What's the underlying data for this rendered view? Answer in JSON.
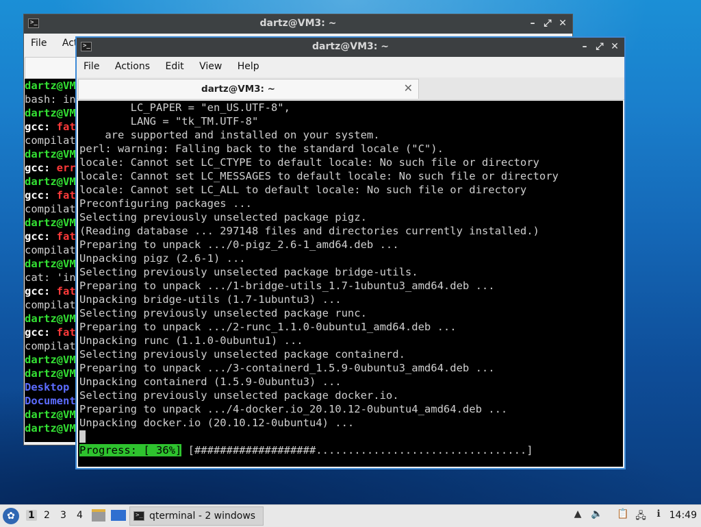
{
  "back_window": {
    "title": "dartz@VM3: ~",
    "menu": [
      "File",
      "Act"
    ],
    "lines": [
      {
        "t": "dartz@VM",
        "c": "g"
      },
      {
        "t": "bash: in",
        "c": ""
      },
      {
        "t": "dartz@VM",
        "c": "g"
      },
      {
        "t": "gcc: fat",
        "c": "mix"
      },
      {
        "t": "compilat",
        "c": ""
      },
      {
        "t": "dartz@VM",
        "c": "g"
      },
      {
        "t": "gcc: err",
        "c": "mix"
      },
      {
        "t": "dartz@VM",
        "c": "g"
      },
      {
        "t": "gcc: fat",
        "c": "mix"
      },
      {
        "t": "compilat",
        "c": ""
      },
      {
        "t": "dartz@VM",
        "c": "g"
      },
      {
        "t": "gcc: fat",
        "c": "mix"
      },
      {
        "t": "compilat",
        "c": ""
      },
      {
        "t": "dartz@VM",
        "c": "g"
      },
      {
        "t": "cat: 'in",
        "c": ""
      },
      {
        "t": "gcc: fat",
        "c": "mix"
      },
      {
        "t": "compilat",
        "c": ""
      },
      {
        "t": "dartz@VM",
        "c": "g"
      },
      {
        "t": "gcc: fat",
        "c": "mix"
      },
      {
        "t": "compilat",
        "c": ""
      },
      {
        "t": "dartz@VM",
        "c": "g"
      },
      {
        "t": "dartz@VM",
        "c": "g"
      },
      {
        "t": "Desktop",
        "c": "b"
      },
      {
        "t": "Document",
        "c": "b"
      },
      {
        "t": "dartz@VM",
        "c": "g"
      },
      {
        "t": "dartz@VM",
        "c": "g"
      }
    ]
  },
  "front_window": {
    "title": "dartz@VM3: ~",
    "menu": {
      "file": "File",
      "actions": "Actions",
      "edit": "Edit",
      "view": "View",
      "help": "Help"
    },
    "tab_label": "dartz@VM3: ~",
    "lines": [
      "        LC_PAPER = \"en_US.UTF-8\",",
      "        LANG = \"tk_TM.UTF-8\"",
      "    are supported and installed on your system.",
      "perl: warning: Falling back to the standard locale (\"C\").",
      "locale: Cannot set LC_CTYPE to default locale: No such file or directory",
      "locale: Cannot set LC_MESSAGES to default locale: No such file or directory",
      "locale: Cannot set LC_ALL to default locale: No such file or directory",
      "Preconfiguring packages ...",
      "Selecting previously unselected package pigz.",
      "(Reading database ... 297148 files and directories currently installed.)",
      "Preparing to unpack .../0-pigz_2.6-1_amd64.deb ...",
      "Unpacking pigz (2.6-1) ...",
      "Selecting previously unselected package bridge-utils.",
      "Preparing to unpack .../1-bridge-utils_1.7-1ubuntu3_amd64.deb ...",
      "Unpacking bridge-utils (1.7-1ubuntu3) ...",
      "Selecting previously unselected package runc.",
      "Preparing to unpack .../2-runc_1.1.0-0ubuntu1_amd64.deb ...",
      "Unpacking runc (1.1.0-0ubuntu1) ...",
      "Selecting previously unselected package containerd.",
      "Preparing to unpack .../3-containerd_1.5.9-0ubuntu3_amd64.deb ...",
      "Unpacking containerd (1.5.9-0ubuntu3) ...",
      "Selecting previously unselected package docker.io.",
      "Preparing to unpack .../4-docker.io_20.10.12-0ubuntu4_amd64.deb ...",
      "Unpacking docker.io (20.10.12-0ubuntu4) ..."
    ],
    "progress_label": "Progress: [ 36%]",
    "progress_bar": " [###################.................................]",
    "progress_percent": 36
  },
  "taskbar": {
    "workspaces": [
      "1",
      "2",
      "3",
      "4"
    ],
    "active_workspace": "1",
    "task_label": "qterminal - 2 windows",
    "clock": "14:49",
    "icons": [
      "start-menu-icon",
      "file-manager-icon",
      "show-desktop-icon",
      "terminal-icon",
      "scroll-up-icon",
      "volume-icon",
      "clipboard-icon",
      "network-icon",
      "update-notifier-icon"
    ]
  },
  "colors": {
    "prompt_green": "#34e234",
    "error_red": "#ff3a3a",
    "dir_blue": "#5c6cff",
    "progress_green": "#2ec22e",
    "titlebar": "#3c3f41",
    "active_border": "#3d8ad6"
  }
}
